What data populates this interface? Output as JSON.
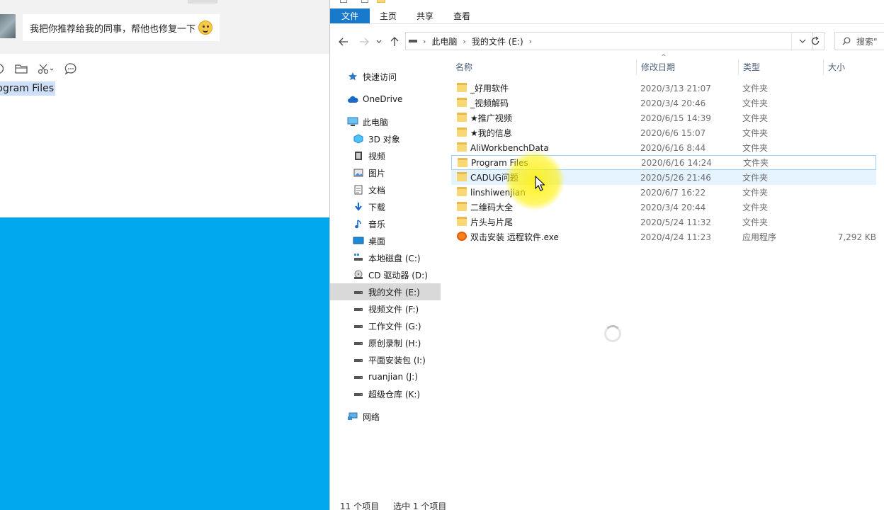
{
  "chat": {
    "message": "我把你推荐给我的同事，帮他也修复一下",
    "input_text": "Program Files",
    "emoji": "smile-emoji"
  },
  "explorer": {
    "ribbon_tabs": [
      "文件",
      "主页",
      "共享",
      "查看"
    ],
    "address": {
      "crumbs": [
        "此电脑",
        "我的文件 (E:)"
      ]
    },
    "search_placeholder": "搜索\"",
    "nav": {
      "quick_access": "快速访问",
      "onedrive": "OneDrive",
      "this_pc": "此电脑",
      "items": [
        {
          "label": "3D 对象",
          "icon": "3d-objects-icon"
        },
        {
          "label": "视频",
          "icon": "video-icon"
        },
        {
          "label": "图片",
          "icon": "pictures-icon"
        },
        {
          "label": "文档",
          "icon": "documents-icon"
        },
        {
          "label": "下载",
          "icon": "download-icon"
        },
        {
          "label": "音乐",
          "icon": "music-icon"
        },
        {
          "label": "桌面",
          "icon": "desktop-icon"
        },
        {
          "label": "本地磁盘 (C:)",
          "icon": "drive-c-icon"
        },
        {
          "label": "CD 驱动器 (D:)",
          "icon": "cd-drive-icon"
        },
        {
          "label": "我的文件 (E:)",
          "icon": "drive-icon",
          "selected": true
        },
        {
          "label": "视频文件 (F:)",
          "icon": "drive-icon"
        },
        {
          "label": "工作文件 (G:)",
          "icon": "drive-icon"
        },
        {
          "label": "原创录制 (H:)",
          "icon": "drive-icon"
        },
        {
          "label": "平面安装包 (I:)",
          "icon": "drive-icon"
        },
        {
          "label": "ruanjian (J:)",
          "icon": "drive-icon"
        },
        {
          "label": "超级仓库 (K:)",
          "icon": "drive-icon"
        }
      ],
      "network": "网络"
    },
    "columns": [
      "名称",
      "修改日期",
      "类型",
      "大小"
    ],
    "files": [
      {
        "name": "_好用软件",
        "date": "2020/3/13 21:07",
        "type": "文件夹",
        "size": "",
        "icon": "folder-icon"
      },
      {
        "name": "_视频解码",
        "date": "2020/3/4 20:46",
        "type": "文件夹",
        "size": "",
        "icon": "folder-icon"
      },
      {
        "name": "★推广视频",
        "date": "2020/6/15 14:39",
        "type": "文件夹",
        "size": "",
        "icon": "folder-icon"
      },
      {
        "name": "★我的信息",
        "date": "2020/6/6 15:07",
        "type": "文件夹",
        "size": "",
        "icon": "folder-icon"
      },
      {
        "name": "AliWorkbenchData",
        "date": "2020/6/16 8:44",
        "type": "文件夹",
        "size": "",
        "icon": "folder-icon"
      },
      {
        "name": "Program Files",
        "date": "2020/6/16 14:24",
        "type": "文件夹",
        "size": "",
        "icon": "folder-icon",
        "selected": true
      },
      {
        "name": "CADUG问题",
        "date": "2020/5/26 21:46",
        "type": "文件夹",
        "size": "",
        "icon": "folder-icon",
        "hover": true
      },
      {
        "name": "linshiwenjian",
        "date": "2020/6/7 16:22",
        "type": "文件夹",
        "size": "",
        "icon": "folder-icon"
      },
      {
        "name": "二维码大全",
        "date": "2020/3/4 20:44",
        "type": "文件夹",
        "size": "",
        "icon": "folder-icon"
      },
      {
        "name": "片头与片尾",
        "date": "2020/5/24 11:32",
        "type": "文件夹",
        "size": "",
        "icon": "folder-icon"
      },
      {
        "name": "双击安装 远程软件.exe",
        "date": "2020/4/24 11:23",
        "type": "应用程序",
        "size": "7,292 KB",
        "icon": "exe-icon"
      }
    ],
    "status": {
      "count": "11 个项目",
      "selected": "选中 1 个项目"
    }
  },
  "colors": {
    "ribbon_active": "#1979ca",
    "desktop": "#02a8ee",
    "selection_border": "#99d1ff",
    "hover_bg": "#e5f3ff"
  }
}
